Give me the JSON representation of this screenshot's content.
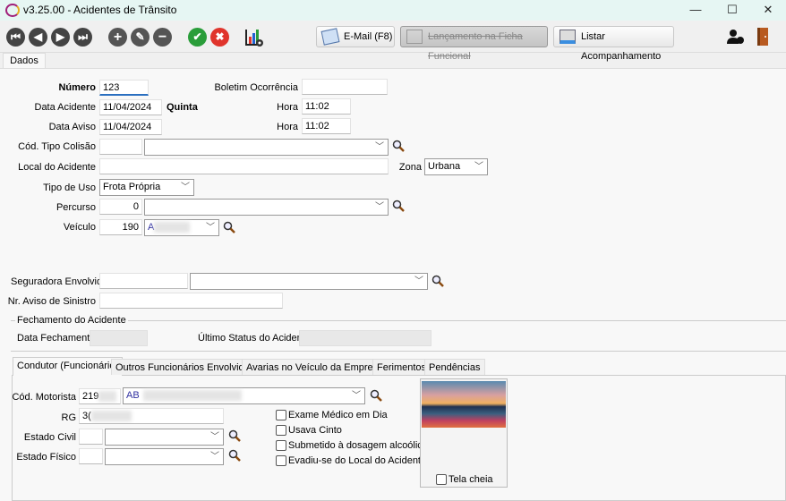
{
  "window": {
    "title": "v3.25.00 - Acidentes de Trânsito",
    "minimize": "—",
    "maximize": "☐",
    "close": "✕"
  },
  "toolbar": {
    "first": "⏮",
    "prev": "◀",
    "next": "▶",
    "last": "⏭",
    "add": "+",
    "edit": "✎",
    "remove": "−",
    "confirm": "✔",
    "cancel": "✖",
    "email_label": "E-Mail (F8)",
    "lancamento_label": "Lançamento na Ficha Funcional",
    "listar_label": "Listar Acompanhamento"
  },
  "tabs": {
    "main": "Dados"
  },
  "form": {
    "numero_label": "Número",
    "numero": "123",
    "boletim_label": "Boletim Ocorrência",
    "boletim": "",
    "data_acidente_label": "Data Acidente",
    "data_acidente": "11/04/2024",
    "dia_semana": "Quinta",
    "hora_label": "Hora",
    "hora_acidente": "11:02",
    "data_aviso_label": "Data Aviso",
    "data_aviso": "11/04/2024",
    "hora_aviso": "11:02",
    "tipo_colisao_label": "Cód. Tipo Colisão",
    "tipo_colisao_code": "",
    "tipo_colisao": "",
    "local_label": "Local do Acidente",
    "local": "",
    "zona_label": "Zona",
    "zona": "Urbana",
    "tipo_uso_label": "Tipo de Uso",
    "tipo_uso": "Frota Própria",
    "percurso_label": "Percurso",
    "percurso_code": "0",
    "percurso": "",
    "veiculo_label": "Veículo",
    "veiculo_code": "190",
    "veiculo": "A",
    "seguradora_label": "Seguradora Envolvida",
    "seguradora_code": "",
    "seguradora": "",
    "aviso_sinistro_label": "Nr. Aviso de Sinistro",
    "aviso_sinistro": ""
  },
  "fechamento": {
    "group_label": "Fechamento do Acidente",
    "data_label": "Data Fechamento",
    "data": "",
    "status_label": "Último Status do Acidente",
    "status": ""
  },
  "subtabs": [
    "Condutor (Funcionário)",
    "Outros Funcionários Envolvidos",
    "Avarias no Veículo da Empresa",
    "Ferimentos",
    "Pendências"
  ],
  "condutor": {
    "motorista_label": "Cód. Motorista",
    "motorista_code": "219",
    "motorista_name": "AB",
    "rg_label": "RG",
    "rg": "3(",
    "estado_civil_label": "Estado Civil",
    "estado_fisico_label": "Estado Físico",
    "checks": [
      {
        "label": "Exame Médico em Dia",
        "checked": false
      },
      {
        "label": "Usava Cinto",
        "checked": false
      },
      {
        "label": "Submetido à dosagem alcoólica",
        "checked": false
      },
      {
        "label": "Evadiu-se do Local do Acidente",
        "checked": false
      }
    ],
    "tela_cheia_label": "Tela cheia"
  },
  "colors": {
    "confirm": "#2a9d3a",
    "cancel": "#e0342c",
    "combo_bg": "#fefee8",
    "title_bg": "#e6f6f3"
  }
}
